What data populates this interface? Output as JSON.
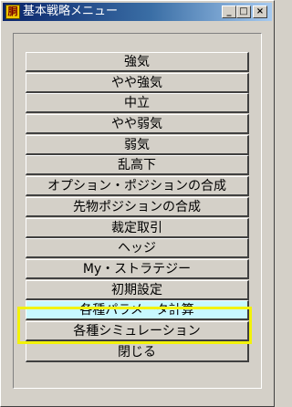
{
  "window": {
    "title": "基本戦略メニュー",
    "icon_glyph": "胴",
    "controls": {
      "minimize": "_",
      "maximize": "□",
      "close": "×"
    }
  },
  "menu": {
    "items": [
      {
        "label": "強気"
      },
      {
        "label": "やや強気"
      },
      {
        "label": "中立"
      },
      {
        "label": "やや弱気"
      },
      {
        "label": "弱気"
      },
      {
        "label": "乱高下"
      },
      {
        "label": "オプション・ポジションの合成"
      },
      {
        "label": "先物ポジションの合成"
      },
      {
        "label": "裁定取引"
      },
      {
        "label": "ヘッジ"
      },
      {
        "label": "My・ストラテジー"
      },
      {
        "label": "初期設定"
      },
      {
        "label": "各種パラメータ計算"
      },
      {
        "label": "各種シミュレーション"
      },
      {
        "label": "閉じる"
      }
    ],
    "selected_item": "各種パラメータ計算"
  },
  "colors": {
    "highlight_border": "#f2f20a",
    "selected_button": "#c8f8ff"
  }
}
